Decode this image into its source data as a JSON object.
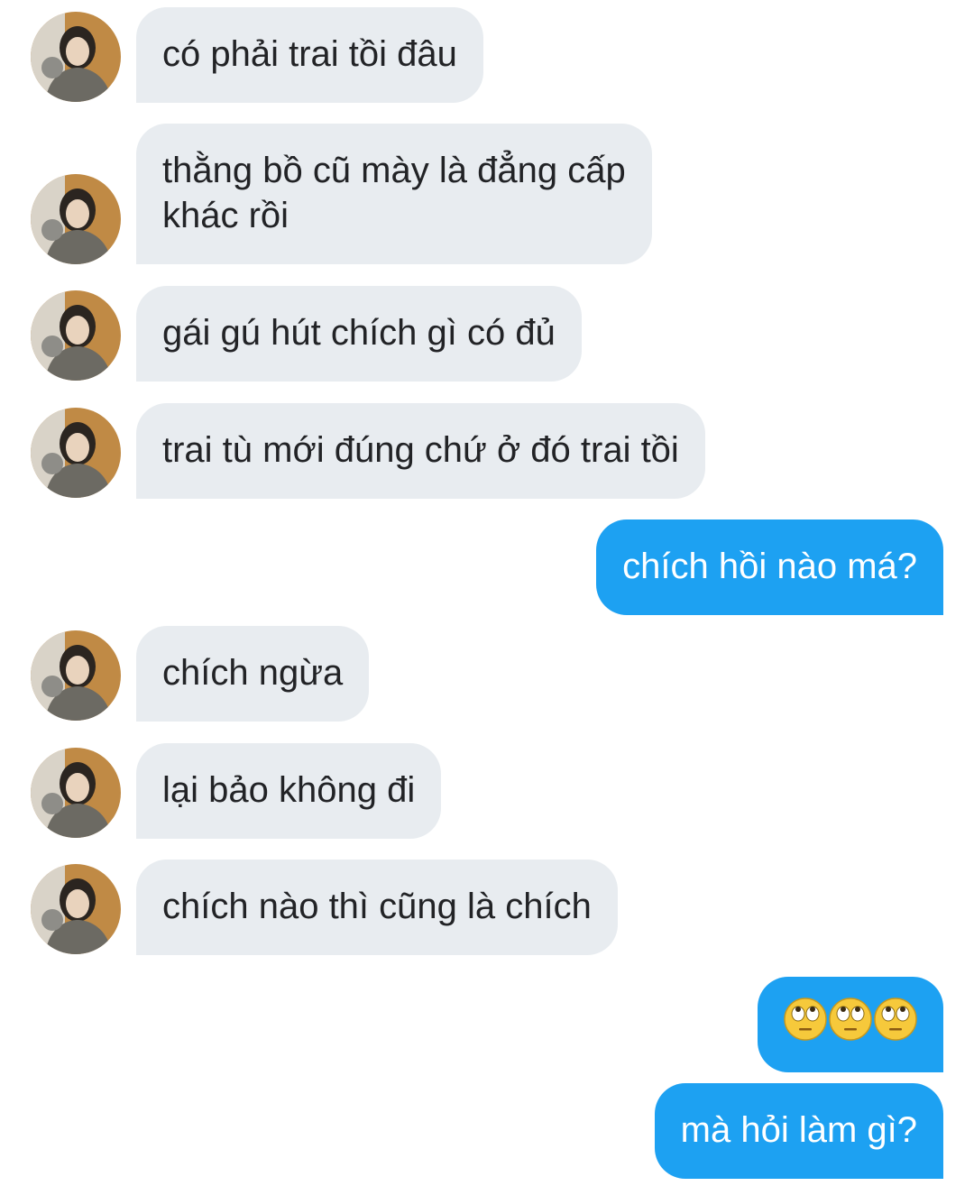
{
  "messages": [
    {
      "side": "in",
      "text": "có phải trai tồi đâu"
    },
    {
      "side": "in",
      "text": "thằng bồ cũ mày là đẳng cấp\nkhác rồi"
    },
    {
      "side": "in",
      "text": "gái gú hút chích gì có đủ"
    },
    {
      "side": "in",
      "text": "trai tù mới đúng chứ ở đó trai tồi"
    },
    {
      "side": "out",
      "text": "chích hồi nào má?"
    },
    {
      "side": "in",
      "text": "chích ngừa"
    },
    {
      "side": "in",
      "text": "lại bảo không đi"
    },
    {
      "side": "in",
      "text": "chích nào thì cũng là chích"
    },
    {
      "side": "out",
      "emoji": [
        "eye-roll-emoji",
        "eye-roll-emoji",
        "eye-roll-emoji"
      ]
    },
    {
      "side": "out",
      "text": "mà hỏi làm gì?"
    }
  ],
  "colors": {
    "incoming_bubble": "#e8ecf0",
    "outgoing_bubble": "#1da1f2",
    "incoming_text": "#222326",
    "outgoing_text": "#ffffff"
  }
}
